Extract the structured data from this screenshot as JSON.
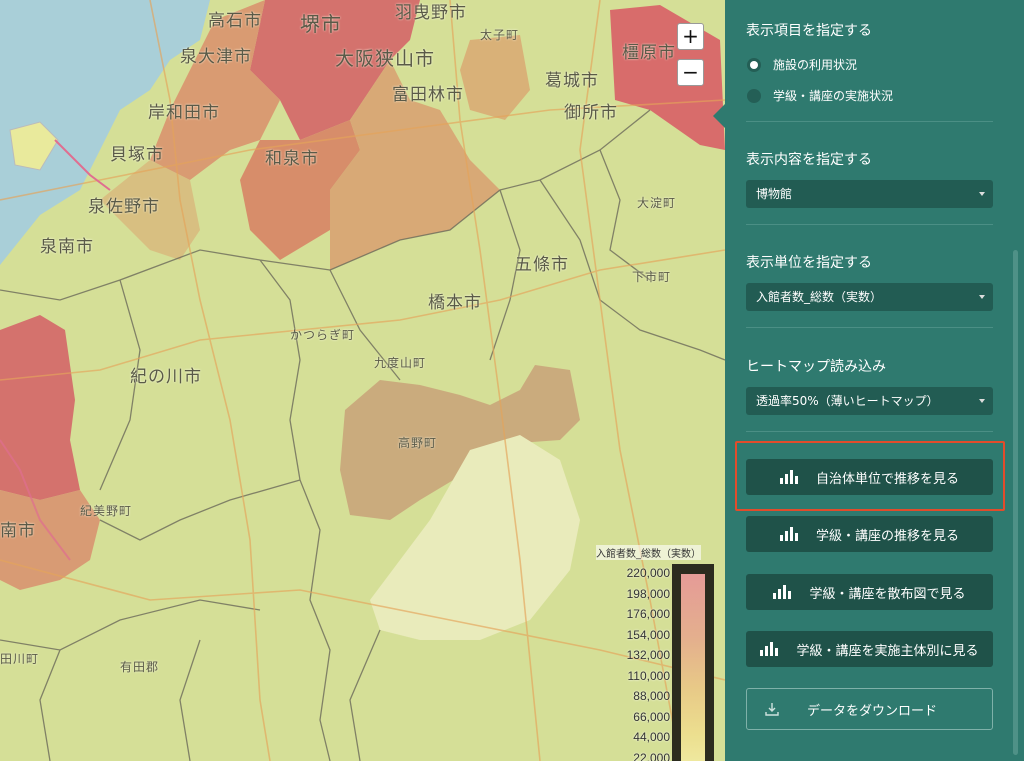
{
  "map": {
    "zoom_in": "+",
    "zoom_out": "−",
    "labels": [
      {
        "text": "高石市",
        "cls": ""
      },
      {
        "text": "堺市",
        "cls": ""
      },
      {
        "text": "羽曳野市",
        "cls": ""
      },
      {
        "text": "泉大津市",
        "cls": ""
      },
      {
        "text": "大阪狭山市",
        "cls": ""
      },
      {
        "text": "太子町",
        "cls": "small"
      },
      {
        "text": "橿原市",
        "cls": ""
      },
      {
        "text": "富田林市",
        "cls": ""
      },
      {
        "text": "葛城市",
        "cls": ""
      },
      {
        "text": "御所市",
        "cls": ""
      },
      {
        "text": "岸和田市",
        "cls": ""
      },
      {
        "text": "貝塚市",
        "cls": ""
      },
      {
        "text": "和泉市",
        "cls": ""
      },
      {
        "text": "泉佐野市",
        "cls": ""
      },
      {
        "text": "大淀町",
        "cls": "small"
      },
      {
        "text": "泉南市",
        "cls": ""
      },
      {
        "text": "五條市",
        "cls": ""
      },
      {
        "text": "下市町",
        "cls": "small"
      },
      {
        "text": "橋本市",
        "cls": ""
      },
      {
        "text": "かつらぎ町",
        "cls": "small"
      },
      {
        "text": "九度山町",
        "cls": "small"
      },
      {
        "text": "紀の川市",
        "cls": ""
      },
      {
        "text": "高野町",
        "cls": "small"
      },
      {
        "text": "紀美野町",
        "cls": "small"
      },
      {
        "text": "南市",
        "cls": ""
      },
      {
        "text": "有田郡",
        "cls": "small"
      },
      {
        "text": "田川町",
        "cls": "small"
      }
    ]
  },
  "legend": {
    "title": "入館者数_総数（実数）",
    "ticks": [
      "220,000",
      "198,000",
      "176,000",
      "154,000",
      "132,000",
      "110,000",
      "88,000",
      "66,000",
      "44,000",
      "22,000"
    ]
  },
  "panel": {
    "display_item": {
      "title": "表示項目を指定する",
      "options": [
        {
          "label": "施設の利用状況",
          "checked": true
        },
        {
          "label": "学級・講座の実施状況",
          "checked": false
        }
      ]
    },
    "display_content": {
      "title": "表示内容を指定する",
      "value": "博物館"
    },
    "display_unit": {
      "title": "表示単位を指定する",
      "value": "入館者数_総数（実数）"
    },
    "heatmap": {
      "title": "ヒートマップ読み込み",
      "value": "透過率50%（薄いヒートマップ）"
    },
    "buttons": [
      "自治体単位で推移を見る",
      "学級・講座の推移を見る",
      "学級・講座を散布図で見る",
      "学級・講座を実施主体別に見る"
    ],
    "download": "データをダウンロード"
  }
}
